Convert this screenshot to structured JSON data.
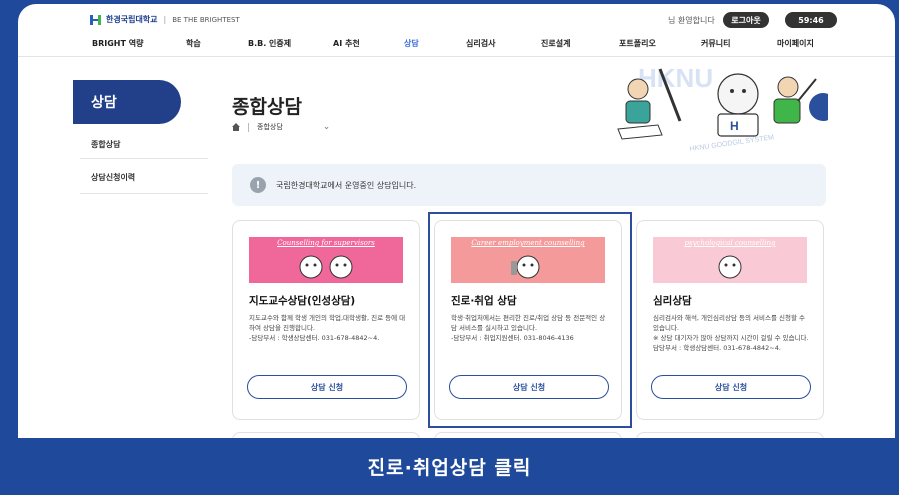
{
  "header": {
    "logo_name": "한경국립대학교",
    "slogan": "BE THE BRIGHTEST",
    "welcome": "님 환영합니다",
    "logout_label": "로그아웃",
    "timer": "59:46"
  },
  "nav": {
    "items": [
      "BRIGHT 역량",
      "학습",
      "B.B. 인증제",
      "AI 추천",
      "상담",
      "심리검사",
      "진로설계",
      "포트폴리오",
      "커뮤니티",
      "마이페이지"
    ],
    "active": "상담"
  },
  "sidebar": {
    "title": "상담",
    "items": [
      "종합상담",
      "상담신청이력"
    ]
  },
  "main": {
    "title": "종합상담",
    "breadcrumb": "종합상담",
    "notice": "국립한경대학교에서 운영중인 상담입니다.",
    "illustration_text": "HKNU GOODGIL SYSTEM",
    "cards": [
      {
        "banner": "Counselling for supervisors",
        "banner_color": "#f0679a",
        "title": "지도교수상담(인성상담)",
        "desc": "지도교수와 함께 학생 개인의 학업,대학생활, 진로 등에 대하여 상담을 진행합니다.\n-담당부서 : 학생상담센터. 031-678-4842~4.",
        "button": "상담 신청"
      },
      {
        "banner": "Career employment counselling",
        "banner_color": "#f49a9a",
        "title": "진로·취업 상담",
        "desc": "학생·취업처에서는 편리한 진로/취업 상담 등 전문적인 상담 서비스를 실시하고 있습니다.\n-담당부서 : 취업지원센터. 031-8046-4136",
        "button": "상담 신청"
      },
      {
        "banner": "psychological counselling",
        "banner_color": "#f9c9d6",
        "title": "심리상담",
        "desc": "심리검사와 해석, 개인심리상담 등의 서비스를 신청할 수 있습니다.\n※ 상담 대기자가 많아 상담까지 시간이 걸릴 수 있습니다.\n담당부서 : 학생상담센터. 031-678-4842~4.",
        "button": "상담 신청"
      }
    ]
  },
  "caption": "진로·취업상담 클릭",
  "colors": {
    "brand": "#1f4a9c",
    "sidebar_active": "#22408a",
    "nav_active": "#3a6fd8"
  }
}
